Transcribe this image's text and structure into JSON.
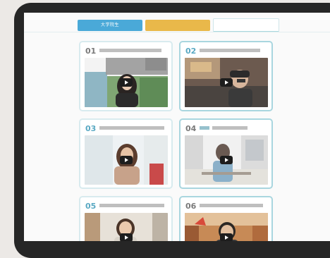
{
  "tabs": [
    {
      "label": "大学院生"
    },
    {
      "label": ""
    },
    {
      "label": ""
    }
  ],
  "cards": [
    {
      "number": "01",
      "caption": ""
    },
    {
      "number": "02",
      "caption": ""
    },
    {
      "number": "03",
      "caption": ""
    },
    {
      "number": "04",
      "caption": ""
    },
    {
      "number": "05",
      "caption": ""
    },
    {
      "number": "06",
      "caption": ""
    }
  ],
  "colors": {
    "accent_blue": "#4aa9d8",
    "accent_yellow": "#e9b84a",
    "number_teal": "#5aa9c3",
    "card_border": "#d8ebef",
    "device_frame": "#262626"
  },
  "icons": [
    "play-icon"
  ]
}
